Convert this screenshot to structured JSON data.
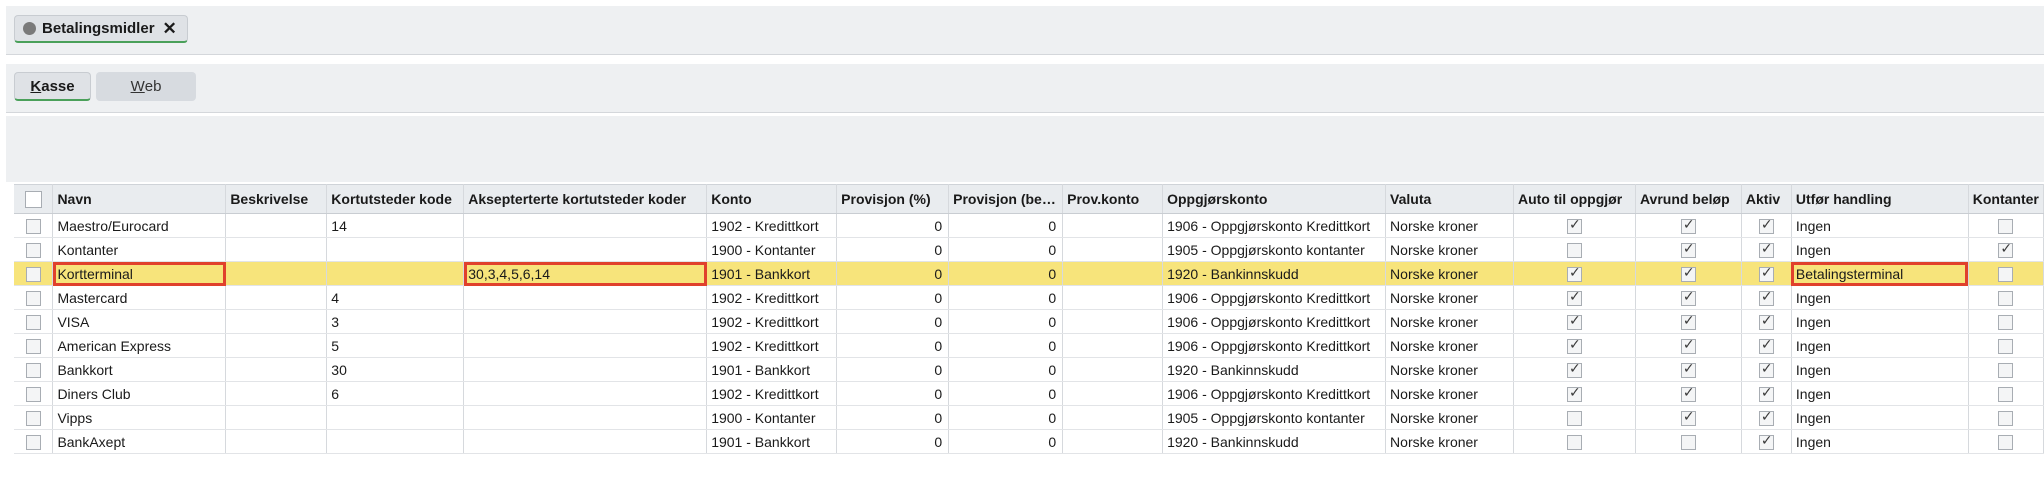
{
  "topbar": {
    "pill_label": "Betalingsmidler",
    "close_glyph": "✕"
  },
  "tabs": {
    "active": {
      "u": "K",
      "rest": "asse"
    },
    "inactive": {
      "u": "W",
      "rest": "eb"
    }
  },
  "columns": [
    "Navn",
    "Beskrivelse",
    "Kortutsteder kode",
    "Aksepterterte kortutsteder koder",
    "Konto",
    "Provisjon (%)",
    "Provisjon (be…",
    "Prov.konto",
    "Oppgjørskonto",
    "Valuta",
    "Auto til oppgjør",
    "Avrund beløp",
    "Aktiv",
    "Utfør handling",
    "Kontanter"
  ],
  "rows": [
    {
      "navn": "Maestro/Eurocard",
      "beskrivelse": "",
      "kode": "14",
      "koder": "",
      "konto": "1902 - Kredittkort",
      "prov_pct": "0",
      "prov_bel": "0",
      "prov_konto": "",
      "oppgjor": "1906 - Oppgjørskonto Kredittkort",
      "valuta": "Norske kroner",
      "auto": true,
      "avrund": true,
      "aktiv": true,
      "handling": "Ingen",
      "kontanter": false
    },
    {
      "navn": "Kontanter",
      "beskrivelse": "",
      "kode": "",
      "koder": "",
      "konto": "1900 - Kontanter",
      "prov_pct": "0",
      "prov_bel": "0",
      "prov_konto": "",
      "oppgjor": "1905 - Oppgjørskonto kontanter",
      "valuta": "Norske kroner",
      "auto": false,
      "avrund": true,
      "aktiv": true,
      "handling": "Ingen",
      "kontanter": true
    },
    {
      "navn": "Kortterminal",
      "beskrivelse": "",
      "kode": "",
      "koder": "30,3,4,5,6,14",
      "konto": "1901 - Bankkort",
      "prov_pct": "0",
      "prov_bel": "0",
      "prov_konto": "",
      "oppgjor": "1920 - Bankinnskudd",
      "valuta": "Norske kroner",
      "auto": true,
      "avrund": true,
      "aktiv": true,
      "handling": "Betalingsterminal",
      "kontanter": false,
      "selected": true
    },
    {
      "navn": "Mastercard",
      "beskrivelse": "",
      "kode": "4",
      "koder": "",
      "konto": "1902 - Kredittkort",
      "prov_pct": "0",
      "prov_bel": "0",
      "prov_konto": "",
      "oppgjor": "1906 - Oppgjørskonto Kredittkort",
      "valuta": "Norske kroner",
      "auto": true,
      "avrund": true,
      "aktiv": true,
      "handling": "Ingen",
      "kontanter": false
    },
    {
      "navn": "VISA",
      "beskrivelse": "",
      "kode": "3",
      "koder": "",
      "konto": "1902 - Kredittkort",
      "prov_pct": "0",
      "prov_bel": "0",
      "prov_konto": "",
      "oppgjor": "1906 - Oppgjørskonto Kredittkort",
      "valuta": "Norske kroner",
      "auto": true,
      "avrund": true,
      "aktiv": true,
      "handling": "Ingen",
      "kontanter": false
    },
    {
      "navn": "American Express",
      "beskrivelse": "",
      "kode": "5",
      "koder": "",
      "konto": "1902 - Kredittkort",
      "prov_pct": "0",
      "prov_bel": "0",
      "prov_konto": "",
      "oppgjor": "1906 - Oppgjørskonto Kredittkort",
      "valuta": "Norske kroner",
      "auto": true,
      "avrund": true,
      "aktiv": true,
      "handling": "Ingen",
      "kontanter": false
    },
    {
      "navn": "Bankkort",
      "beskrivelse": "",
      "kode": "30",
      "koder": "",
      "konto": "1901 - Bankkort",
      "prov_pct": "0",
      "prov_bel": "0",
      "prov_konto": "",
      "oppgjor": "1920 - Bankinnskudd",
      "valuta": "Norske kroner",
      "auto": true,
      "avrund": true,
      "aktiv": true,
      "handling": "Ingen",
      "kontanter": false
    },
    {
      "navn": "Diners Club",
      "beskrivelse": "",
      "kode": "6",
      "koder": "",
      "konto": "1902 - Kredittkort",
      "prov_pct": "0",
      "prov_bel": "0",
      "prov_konto": "",
      "oppgjor": "1906 - Oppgjørskonto Kredittkort",
      "valuta": "Norske kroner",
      "auto": true,
      "avrund": true,
      "aktiv": true,
      "handling": "Ingen",
      "kontanter": false
    },
    {
      "navn": "Vipps",
      "beskrivelse": "",
      "kode": "",
      "koder": "",
      "konto": "1900 - Kontanter",
      "prov_pct": "0",
      "prov_bel": "0",
      "prov_konto": "",
      "oppgjor": "1905 - Oppgjørskonto kontanter",
      "valuta": "Norske kroner",
      "auto": false,
      "avrund": true,
      "aktiv": true,
      "handling": "Ingen",
      "kontanter": false
    },
    {
      "navn": "BankAxept",
      "beskrivelse": "",
      "kode": "",
      "koder": "",
      "konto": "1901 - Bankkort",
      "prov_pct": "0",
      "prov_bel": "0",
      "prov_konto": "",
      "oppgjor": "1920 - Bankinnskudd",
      "valuta": "Norske kroner",
      "auto": false,
      "avrund": false,
      "aktiv": true,
      "handling": "Ingen",
      "kontanter": false
    }
  ]
}
